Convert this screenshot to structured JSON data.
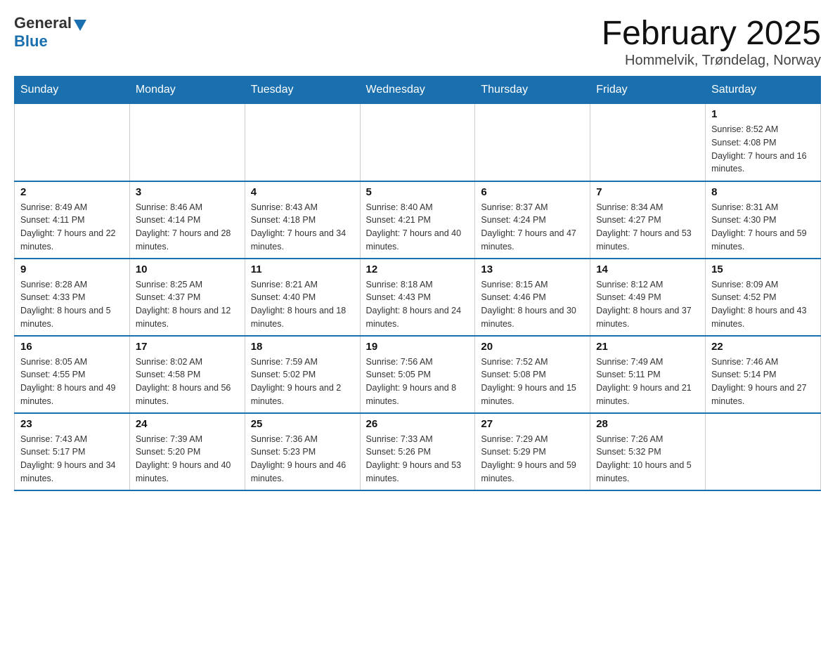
{
  "header": {
    "logo": {
      "text_general": "General",
      "text_blue": "Blue",
      "arrow_alt": "GeneralBlue logo arrow"
    },
    "title": "February 2025",
    "subtitle": "Hommelvik, Trøndelag, Norway"
  },
  "weekdays": [
    "Sunday",
    "Monday",
    "Tuesday",
    "Wednesday",
    "Thursday",
    "Friday",
    "Saturday"
  ],
  "weeks": [
    {
      "days": [
        {
          "number": "",
          "info": ""
        },
        {
          "number": "",
          "info": ""
        },
        {
          "number": "",
          "info": ""
        },
        {
          "number": "",
          "info": ""
        },
        {
          "number": "",
          "info": ""
        },
        {
          "number": "",
          "info": ""
        },
        {
          "number": "1",
          "info": "Sunrise: 8:52 AM\nSunset: 4:08 PM\nDaylight: 7 hours and 16 minutes."
        }
      ]
    },
    {
      "days": [
        {
          "number": "2",
          "info": "Sunrise: 8:49 AM\nSunset: 4:11 PM\nDaylight: 7 hours and 22 minutes."
        },
        {
          "number": "3",
          "info": "Sunrise: 8:46 AM\nSunset: 4:14 PM\nDaylight: 7 hours and 28 minutes."
        },
        {
          "number": "4",
          "info": "Sunrise: 8:43 AM\nSunset: 4:18 PM\nDaylight: 7 hours and 34 minutes."
        },
        {
          "number": "5",
          "info": "Sunrise: 8:40 AM\nSunset: 4:21 PM\nDaylight: 7 hours and 40 minutes."
        },
        {
          "number": "6",
          "info": "Sunrise: 8:37 AM\nSunset: 4:24 PM\nDaylight: 7 hours and 47 minutes."
        },
        {
          "number": "7",
          "info": "Sunrise: 8:34 AM\nSunset: 4:27 PM\nDaylight: 7 hours and 53 minutes."
        },
        {
          "number": "8",
          "info": "Sunrise: 8:31 AM\nSunset: 4:30 PM\nDaylight: 7 hours and 59 minutes."
        }
      ]
    },
    {
      "days": [
        {
          "number": "9",
          "info": "Sunrise: 8:28 AM\nSunset: 4:33 PM\nDaylight: 8 hours and 5 minutes."
        },
        {
          "number": "10",
          "info": "Sunrise: 8:25 AM\nSunset: 4:37 PM\nDaylight: 8 hours and 12 minutes."
        },
        {
          "number": "11",
          "info": "Sunrise: 8:21 AM\nSunset: 4:40 PM\nDaylight: 8 hours and 18 minutes."
        },
        {
          "number": "12",
          "info": "Sunrise: 8:18 AM\nSunset: 4:43 PM\nDaylight: 8 hours and 24 minutes."
        },
        {
          "number": "13",
          "info": "Sunrise: 8:15 AM\nSunset: 4:46 PM\nDaylight: 8 hours and 30 minutes."
        },
        {
          "number": "14",
          "info": "Sunrise: 8:12 AM\nSunset: 4:49 PM\nDaylight: 8 hours and 37 minutes."
        },
        {
          "number": "15",
          "info": "Sunrise: 8:09 AM\nSunset: 4:52 PM\nDaylight: 8 hours and 43 minutes."
        }
      ]
    },
    {
      "days": [
        {
          "number": "16",
          "info": "Sunrise: 8:05 AM\nSunset: 4:55 PM\nDaylight: 8 hours and 49 minutes."
        },
        {
          "number": "17",
          "info": "Sunrise: 8:02 AM\nSunset: 4:58 PM\nDaylight: 8 hours and 56 minutes."
        },
        {
          "number": "18",
          "info": "Sunrise: 7:59 AM\nSunset: 5:02 PM\nDaylight: 9 hours and 2 minutes."
        },
        {
          "number": "19",
          "info": "Sunrise: 7:56 AM\nSunset: 5:05 PM\nDaylight: 9 hours and 8 minutes."
        },
        {
          "number": "20",
          "info": "Sunrise: 7:52 AM\nSunset: 5:08 PM\nDaylight: 9 hours and 15 minutes."
        },
        {
          "number": "21",
          "info": "Sunrise: 7:49 AM\nSunset: 5:11 PM\nDaylight: 9 hours and 21 minutes."
        },
        {
          "number": "22",
          "info": "Sunrise: 7:46 AM\nSunset: 5:14 PM\nDaylight: 9 hours and 27 minutes."
        }
      ]
    },
    {
      "days": [
        {
          "number": "23",
          "info": "Sunrise: 7:43 AM\nSunset: 5:17 PM\nDaylight: 9 hours and 34 minutes."
        },
        {
          "number": "24",
          "info": "Sunrise: 7:39 AM\nSunset: 5:20 PM\nDaylight: 9 hours and 40 minutes."
        },
        {
          "number": "25",
          "info": "Sunrise: 7:36 AM\nSunset: 5:23 PM\nDaylight: 9 hours and 46 minutes."
        },
        {
          "number": "26",
          "info": "Sunrise: 7:33 AM\nSunset: 5:26 PM\nDaylight: 9 hours and 53 minutes."
        },
        {
          "number": "27",
          "info": "Sunrise: 7:29 AM\nSunset: 5:29 PM\nDaylight: 9 hours and 59 minutes."
        },
        {
          "number": "28",
          "info": "Sunrise: 7:26 AM\nSunset: 5:32 PM\nDaylight: 10 hours and 5 minutes."
        },
        {
          "number": "",
          "info": ""
        }
      ]
    }
  ]
}
